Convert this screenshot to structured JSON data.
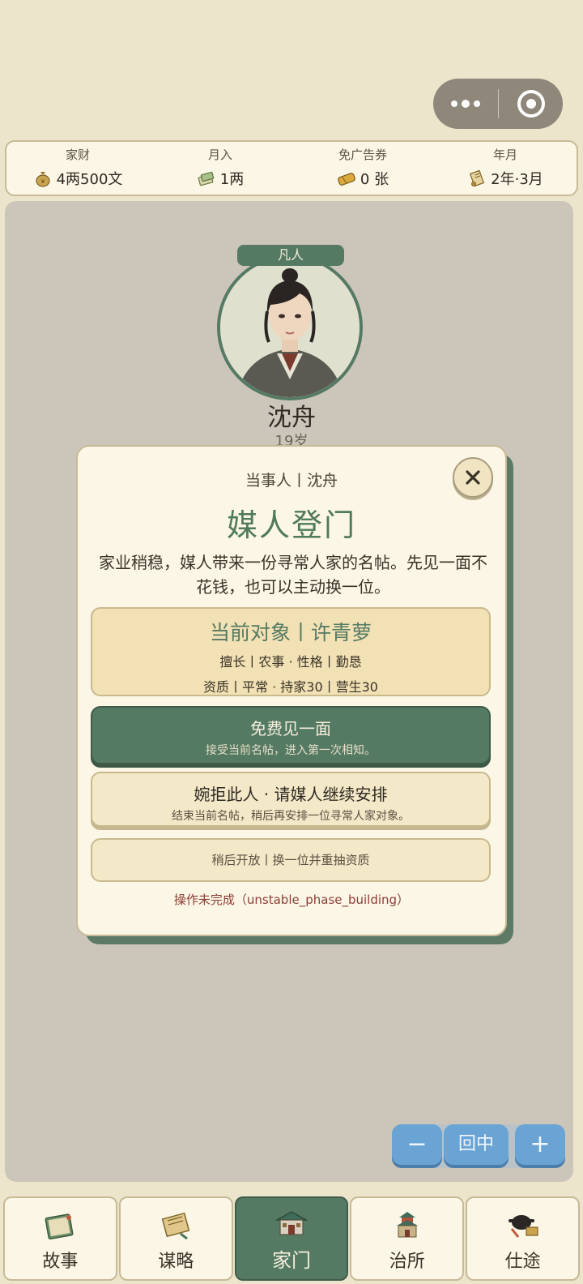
{
  "stats": [
    {
      "label": "家财",
      "value": "4两500文",
      "icon": "money-bag-icon"
    },
    {
      "label": "月入",
      "value": "1两",
      "icon": "money-notes-icon"
    },
    {
      "label": "免广告券",
      "value": "0 张",
      "icon": "ticket-icon"
    },
    {
      "label": "年月",
      "value": "2年·3月",
      "icon": "scroll-icon"
    }
  ],
  "character": {
    "rank": "凡人",
    "name": "沈舟",
    "age": "19岁"
  },
  "modal": {
    "subtitle": "当事人丨沈舟",
    "title": "媒人登门",
    "description": "家业稍稳，媒人带来一份寻常人家的名帖。先见一面不花钱，也可以主动换一位。",
    "target": {
      "title": "当前对象丨许青萝",
      "line1": "擅长丨农事 · 性格丨勤恳",
      "line2": "资质丨平常 · 持家30丨营生30"
    },
    "primary": {
      "label": "免费见一面",
      "sub": "接受当前名帖，进入第一次相知。"
    },
    "secondary": {
      "label": "婉拒此人 · 请媒人继续安排",
      "sub": "结束当前名帖，稍后再安排一位寻常人家对象。"
    },
    "tertiary": {
      "label": "稍后开放丨换一位并重抽资质"
    },
    "status": "操作未完成（unstable_phase_building）"
  },
  "zoom": {
    "minus": "−",
    "center": "回中",
    "plus": "+"
  },
  "nav": [
    {
      "label": "故事",
      "icon": "story-book-icon",
      "active": false
    },
    {
      "label": "谋略",
      "icon": "strategy-scroll-icon",
      "active": false
    },
    {
      "label": "家门",
      "icon": "house-icon",
      "active": true
    },
    {
      "label": "治所",
      "icon": "tower-icon",
      "active": false
    },
    {
      "label": "仕途",
      "icon": "official-hat-icon",
      "active": false
    }
  ],
  "colors": {
    "accent": "#557a63",
    "background": "#ece4cb",
    "board": "#ccc6ba",
    "zoom": "#6aa4d4",
    "status": "#8b3e34"
  }
}
